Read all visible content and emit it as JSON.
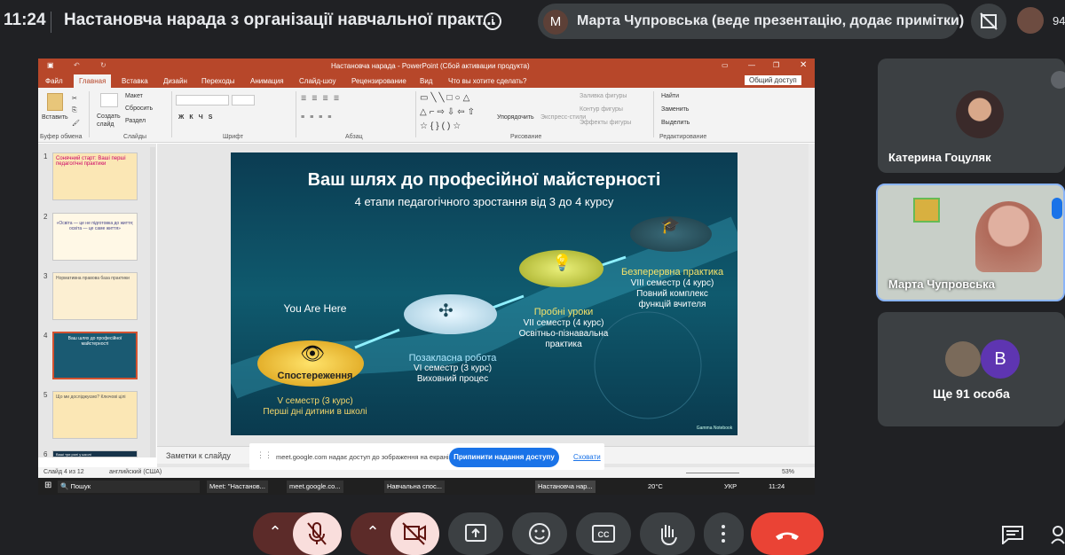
{
  "topbar": {
    "time": "11:24",
    "meeting_title": "Настановча нарада з організації навчальної практ...",
    "presenter_initial": "М",
    "presenter_text": "Марта Чупровська (веде презентацію, додає примітки)",
    "participant_count": "94"
  },
  "ppt": {
    "window_title": "Настановча нарада - PowerPoint (Сбой активации продукта)",
    "tabs": [
      "Файл",
      "Главная",
      "Вставка",
      "Дизайн",
      "Переходы",
      "Анимация",
      "Слайд-шоу",
      "Рецензирование",
      "Вид"
    ],
    "search_hint": "Что вы хотите сделать?",
    "share": "Общий доступ",
    "ribbon": {
      "paste": "Вставить",
      "create_slide": "Создать слайд",
      "layout": "Макет",
      "reset": "Сбросить",
      "section": "Раздел",
      "arrange": "Упорядочить",
      "quick_styles": "Экспресс-стили",
      "fill": "Заливка фигуры",
      "outline": "Контур фигуры",
      "effects": "Эффекты фигуры",
      "find": "Найти",
      "replace": "Заменить",
      "select": "Выделить",
      "groups": {
        "clipboard": "Буфер обмена",
        "slides": "Слайды",
        "font": "Шрифт",
        "paragraph": "Абзац",
        "drawing": "Рисование",
        "editing": "Редактирование"
      }
    },
    "thumbs": [
      {
        "n": "1",
        "text": "Сонячний старт: Ваші перші педагогічні практики",
        "bg": "#fbe7b5"
      },
      {
        "n": "2",
        "text": "«Освіта — це не підготовка до життя; освіта — це саме життя»",
        "bg": "#fff8e6"
      },
      {
        "n": "3",
        "text": "Нормативна правова база практики",
        "bg": "#fcefd2"
      },
      {
        "n": "4",
        "text": "Ваш шлях до професійної майстерності",
        "bg": "#1a5a72"
      },
      {
        "n": "5",
        "text": "Що ми досліджуємо? Ключові цілі",
        "bg": "#fbe7b5"
      },
      {
        "n": "6",
        "text": "Ваші три ролі у школі",
        "bg": "#17344a"
      }
    ],
    "notes_placeholder": "Заметки к слайду",
    "status": {
      "slide_info": "Слайд 4 из 12",
      "language": "английский (США)",
      "zoom": "53%"
    },
    "taskbar": {
      "search": "Пошук",
      "items": [
        "Meet: \"Настанов...",
        "meet.google.co...",
        "Навчальна спос...",
        "Настановча нар..."
      ],
      "weather": "20°C",
      "lang": "УКР",
      "clock": "11:24"
    }
  },
  "slide": {
    "title": "Ваш шлях до професійної майстерності",
    "subtitle": "4 етапи педагогічного зростання від 3 до 4 курсу",
    "you_are_here": "You Are Here",
    "stages": [
      {
        "title": "Спостереження",
        "line1": "V семестр (3 курс)",
        "line2": "Перші дні дитини в школі",
        "line3": ""
      },
      {
        "title": "Позакласна робота",
        "line1": "VI семестр (3 курс)",
        "line2": "Виховний процес",
        "line3": ""
      },
      {
        "title": "Пробні уроки",
        "line1": "VII семестр (4 курс)",
        "line2": "Освітньо-пізнавальна",
        "line3": "практика"
      },
      {
        "title": "Безперервна практика",
        "line1": "VIII семестр (4 курс)",
        "line2": "Повний комплекс",
        "line3": "функцій вчителя"
      }
    ],
    "watermark": "Gamma Notebook"
  },
  "share_banner": {
    "text": "meet.google.com надає доступ до зображення на екрані.",
    "stop": "Припинити надання доступу",
    "hide": "Сховати"
  },
  "tiles": [
    {
      "name": "Катерина Гоцуляк"
    },
    {
      "name": "Марта Чупровська"
    },
    {
      "initial": "В",
      "name": "Ще 91 особа"
    }
  ]
}
